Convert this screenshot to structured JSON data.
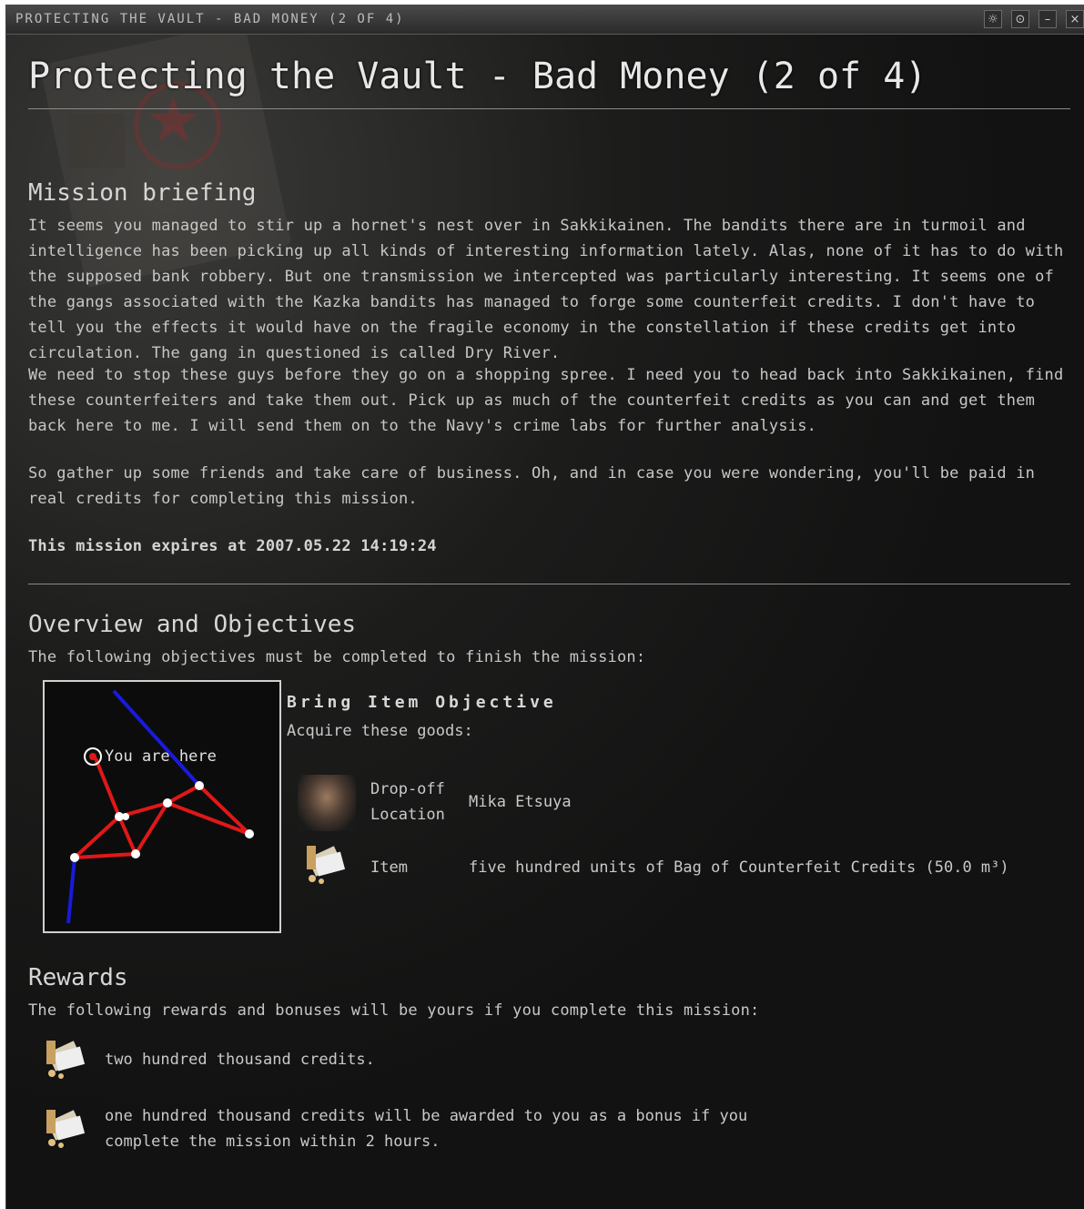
{
  "window": {
    "title": "PROTECTING THE VAULT - BAD MONEY (2 OF 4)",
    "buttons": [
      "☼",
      "⊙",
      "–",
      "×"
    ]
  },
  "heading": "Protecting the Vault - Bad Money (2 of 4)",
  "briefing": {
    "title": "Mission briefing",
    "paragraphs": [
      "It seems you managed to stir up a hornet's nest over in Sakkikainen. The bandits there are in turmoil and intelligence has been picking up all kinds of interesting information lately. Alas, none of it has to do with the supposed bank robbery. But one transmission we intercepted was particularly interesting. It seems one of the gangs associated with the Kazka bandits has managed to forge some counterfeit credits. I don't have to tell you the effects it would have on the fragile economy in the constellation if these credits get into circulation. The gang in questioned is called Dry River.",
      "We need to stop these guys before they go on a shopping spree. I need you to head back into Sakkikainen, find these counterfeiters and take them out. Pick up as much of the counterfeit credits as you can and get them back here to me. I will send them on to the Navy's crime labs for further analysis.",
      "So gather up some friends and take care of business. Oh, and in case you were wondering, you'll be paid in real credits for completing this mission."
    ],
    "expiry": "This mission expires at 2007.05.22 14:19:24"
  },
  "overview": {
    "title": "Overview and Objectives",
    "intro": "The following objectives must be completed to finish the mission:",
    "map_label": "You are here",
    "objective_title": "Bring Item Objective",
    "objective_sub": "Acquire these goods:",
    "dropoff_label_line1": "Drop-off",
    "dropoff_label_line2": "Location",
    "dropoff_value": "Mika Etsuya",
    "item_label": "Item",
    "item_value": "five hundred units of Bag of Counterfeit Credits (50.0 m³)"
  },
  "rewards": {
    "title": "Rewards",
    "intro": "The following rewards and bonuses will be yours if you complete this mission:",
    "reward": "two hundred thousand credits.",
    "bonus_line1": "one hundred thousand credits will be awarded to you as a bonus if you",
    "bonus_line2": "complete the mission within 2 hours."
  }
}
